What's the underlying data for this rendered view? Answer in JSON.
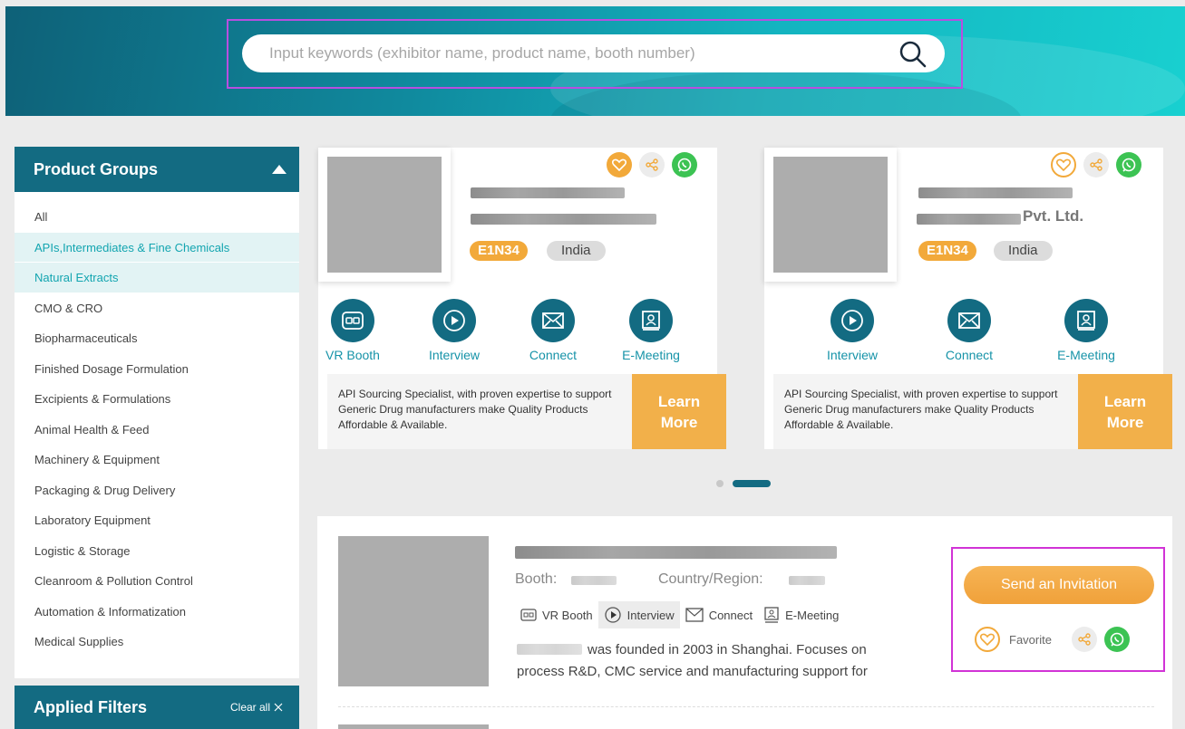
{
  "search": {
    "placeholder": "Input keywords (exhibitor name, product name, booth number)"
  },
  "sidebar": {
    "title": "Product Groups",
    "items": [
      {
        "label": "All",
        "active": false
      },
      {
        "label": "APIs,Intermediates & Fine Chemicals",
        "active": true
      },
      {
        "label": "Natural Extracts",
        "active": true
      },
      {
        "label": "CMO & CRO",
        "active": false
      },
      {
        "label": "Biopharmaceuticals",
        "active": false
      },
      {
        "label": "Finished Dosage Formulation",
        "active": false
      },
      {
        "label": "Excipients & Formulations",
        "active": false
      },
      {
        "label": "Animal Health & Feed",
        "active": false
      },
      {
        "label": "Machinery & Equipment",
        "active": false
      },
      {
        "label": "Packaging & Drug Delivery",
        "active": false
      },
      {
        "label": "Laboratory Equipment",
        "active": false
      },
      {
        "label": "Logistic & Storage",
        "active": false
      },
      {
        "label": "Cleanroom & Pollution Control",
        "active": false
      },
      {
        "label": "Automation & Informatization",
        "active": false
      },
      {
        "label": "Medical Supplies",
        "active": false
      }
    ]
  },
  "applied_filters": {
    "title": "Applied Filters",
    "clear_label": "Clear all"
  },
  "featured": [
    {
      "booth": "E1N34",
      "country": "India",
      "name_visible": "",
      "features": [
        "VR Booth",
        "Interview",
        "Connect",
        "E-Meeting"
      ],
      "description": "API Sourcing Specialist, with proven expertise to support Generic Drug manufacturers make Quality Products Affordable & Available.",
      "learn_more": "Learn More"
    },
    {
      "booth": "E1N34",
      "country": "India",
      "name_visible": "Pvt. Ltd.",
      "features": [
        "Interview",
        "Connect",
        "E-Meeting"
      ],
      "description": "API Sourcing Specialist, with proven expertise to support Generic Drug manufacturers make Quality Products Affordable & Available.",
      "learn_more": "Learn More"
    }
  ],
  "carousel": {
    "count": 2,
    "active_index": 1
  },
  "listing": {
    "booth_label": "Booth:",
    "country_label": "Country/Region:",
    "features": [
      "VR Booth",
      "Interview",
      "Connect",
      "E-Meeting"
    ],
    "description": "was founded in 2003 in Shanghai. Focuses on process R&D, CMC service and manufacturing support for",
    "invite_label": "Send an Invitation",
    "favorite_label": "Favorite"
  },
  "colors": {
    "brand_teal": "#136b82",
    "accent_orange": "#f2a93a",
    "whatsapp_green": "#3cc353",
    "link_teal": "#1693a8"
  }
}
